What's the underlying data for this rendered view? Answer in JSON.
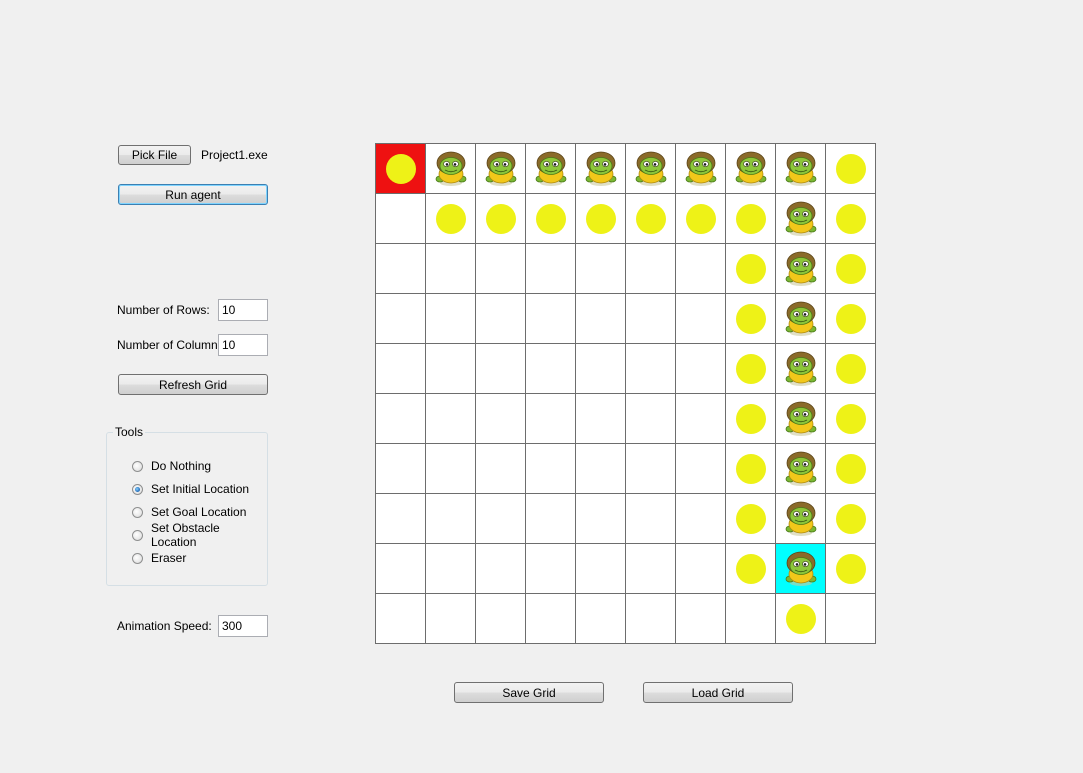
{
  "controls": {
    "pick_file_label": "Pick File",
    "file_name": "Project1.exe",
    "run_agent_label": "Run agent",
    "rows_label": "Number of Rows:",
    "rows_value": "10",
    "columns_label": "Number of Columns:",
    "columns_value": "10",
    "refresh_label": "Refresh Grid",
    "animation_label": "Animation Speed:",
    "animation_value": "300",
    "save_label": "Save Grid",
    "load_label": "Load Grid"
  },
  "tools": {
    "title": "Tools",
    "options": [
      {
        "label": "Do Nothing",
        "checked": false
      },
      {
        "label": "Set Initial Location",
        "checked": true
      },
      {
        "label": "Set Goal Location",
        "checked": false
      },
      {
        "label": "Set Obstacle Location",
        "checked": false
      },
      {
        "label": "Eraser",
        "checked": false
      }
    ]
  },
  "colors": {
    "initial_cell": "#ee1111",
    "goal_cell": "#00ffff",
    "path_dot": "#eef217"
  },
  "grid": {
    "rows": 10,
    "columns": 10,
    "cells": [
      [
        "S",
        "T",
        "T",
        "T",
        "T",
        "T",
        "T",
        "T",
        "T",
        "D"
      ],
      [
        "",
        "D",
        "D",
        "D",
        "D",
        "D",
        "D",
        "D",
        "T",
        "D"
      ],
      [
        "",
        "",
        "",
        "",
        "",
        "",
        "",
        "D",
        "T",
        "D"
      ],
      [
        "",
        "",
        "",
        "",
        "",
        "",
        "",
        "D",
        "T",
        "D"
      ],
      [
        "",
        "",
        "",
        "",
        "",
        "",
        "",
        "D",
        "T",
        "D"
      ],
      [
        "",
        "",
        "",
        "",
        "",
        "",
        "",
        "D",
        "T",
        "D"
      ],
      [
        "",
        "",
        "",
        "",
        "",
        "",
        "",
        "D",
        "T",
        "D"
      ],
      [
        "",
        "",
        "",
        "",
        "",
        "",
        "",
        "D",
        "T",
        "D"
      ],
      [
        "",
        "",
        "",
        "",
        "",
        "",
        "",
        "D",
        "G",
        "D"
      ],
      [
        "",
        "",
        "",
        "",
        "",
        "",
        "",
        "",
        "D",
        ""
      ]
    ]
  }
}
